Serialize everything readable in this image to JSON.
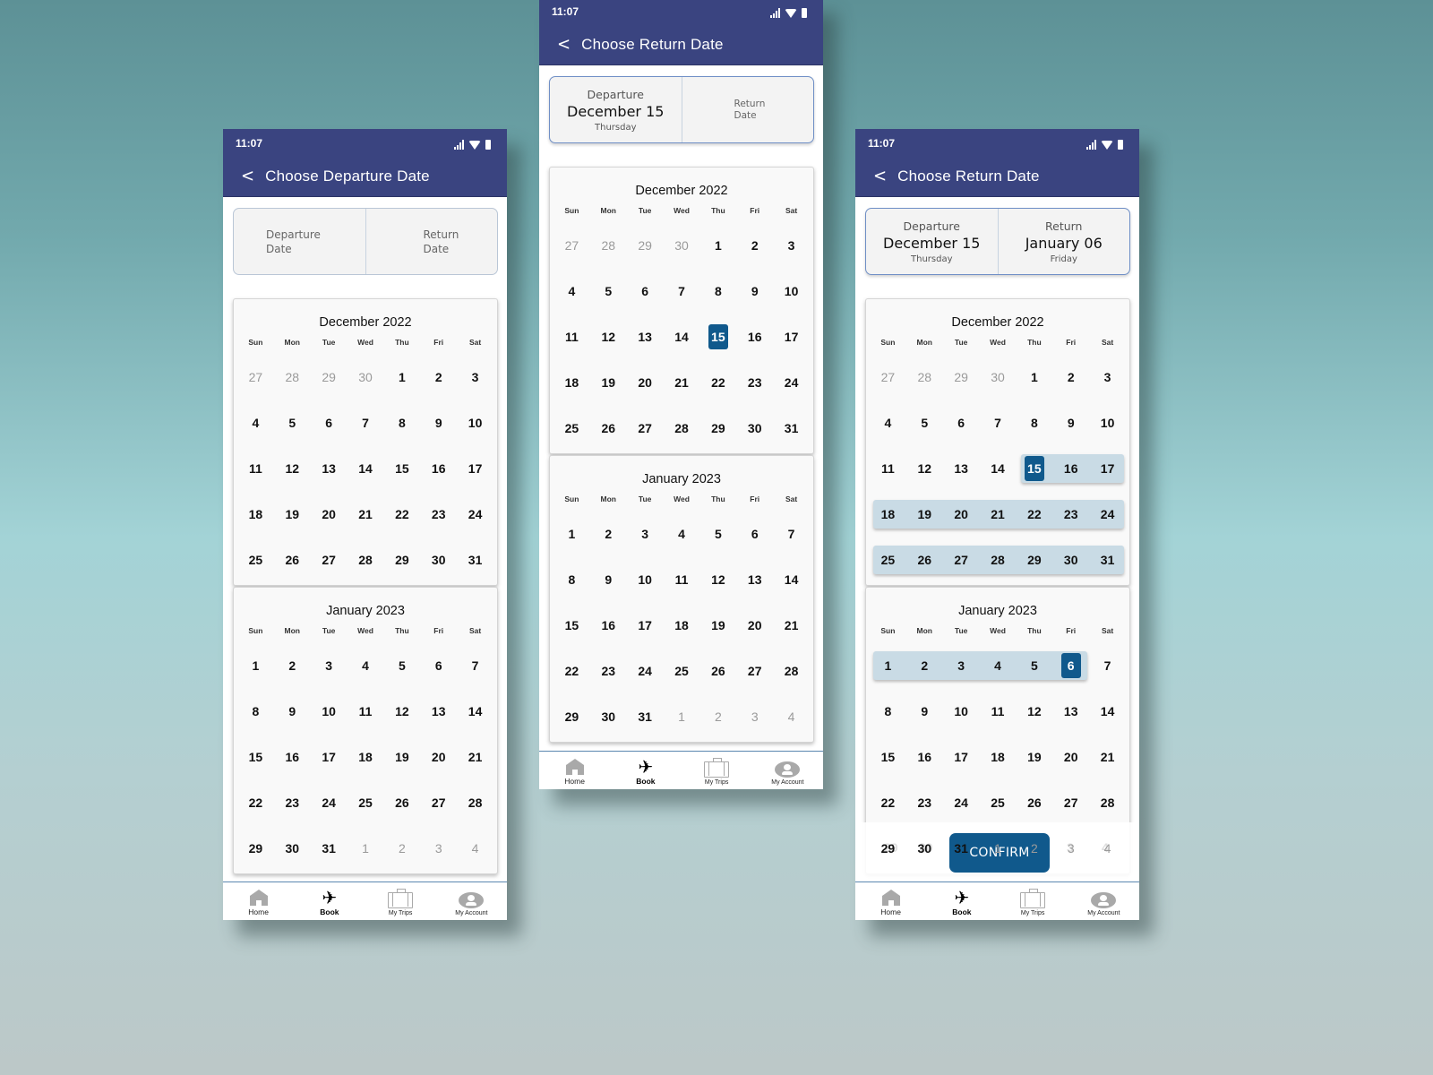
{
  "colors": {
    "appbar": "#3a4480",
    "selected_day": "#10598c",
    "range_fill": "#c9dbe5",
    "confirm_button": "#10598c"
  },
  "weekday_headers": [
    "Sun",
    "Mon",
    "Tue",
    "Wed",
    "Thu",
    "Fri",
    "Sat"
  ],
  "nav": {
    "items": [
      {
        "label": "Home",
        "icon": "home-icon"
      },
      {
        "label": "Book",
        "icon": "airplane-icon",
        "active": true
      },
      {
        "label": "My Trips",
        "icon": "suitcase-icon"
      },
      {
        "label": "My Account",
        "icon": "account-icon"
      }
    ]
  },
  "status": {
    "time": "11:07"
  },
  "months": {
    "dec": {
      "title": "December 2022",
      "weeks": [
        [
          [
            "27",
            1
          ],
          [
            "28",
            1
          ],
          [
            "29",
            1
          ],
          [
            "30",
            1
          ],
          [
            "1",
            0
          ],
          [
            "2",
            0
          ],
          [
            "3",
            0
          ]
        ],
        [
          [
            "4",
            0
          ],
          [
            "5",
            0
          ],
          [
            "6",
            0
          ],
          [
            "7",
            0
          ],
          [
            "8",
            0
          ],
          [
            "9",
            0
          ],
          [
            "10",
            0
          ]
        ],
        [
          [
            "11",
            0
          ],
          [
            "12",
            0
          ],
          [
            "13",
            0
          ],
          [
            "14",
            0
          ],
          [
            "15",
            0
          ],
          [
            "16",
            0
          ],
          [
            "17",
            0
          ]
        ],
        [
          [
            "18",
            0
          ],
          [
            "19",
            0
          ],
          [
            "20",
            0
          ],
          [
            "21",
            0
          ],
          [
            "22",
            0
          ],
          [
            "23",
            0
          ],
          [
            "24",
            0
          ]
        ],
        [
          [
            "25",
            0
          ],
          [
            "26",
            0
          ],
          [
            "27",
            0
          ],
          [
            "28",
            0
          ],
          [
            "29",
            0
          ],
          [
            "30",
            0
          ],
          [
            "31",
            0
          ]
        ]
      ]
    },
    "jan": {
      "title": "January 2023",
      "weeks": [
        [
          [
            "1",
            0
          ],
          [
            "2",
            0
          ],
          [
            "3",
            0
          ],
          [
            "4",
            0
          ],
          [
            "5",
            0
          ],
          [
            "6",
            0
          ],
          [
            "7",
            0
          ]
        ],
        [
          [
            "8",
            0
          ],
          [
            "9",
            0
          ],
          [
            "10",
            0
          ],
          [
            "11",
            0
          ],
          [
            "12",
            0
          ],
          [
            "13",
            0
          ],
          [
            "14",
            0
          ]
        ],
        [
          [
            "15",
            0
          ],
          [
            "16",
            0
          ],
          [
            "17",
            0
          ],
          [
            "18",
            0
          ],
          [
            "19",
            0
          ],
          [
            "20",
            0
          ],
          [
            "21",
            0
          ]
        ],
        [
          [
            "22",
            0
          ],
          [
            "23",
            0
          ],
          [
            "24",
            0
          ],
          [
            "25",
            0
          ],
          [
            "26",
            0
          ],
          [
            "27",
            0
          ],
          [
            "28",
            0
          ]
        ],
        [
          [
            "29",
            0
          ],
          [
            "30",
            0
          ],
          [
            "31",
            0
          ],
          [
            "1",
            1
          ],
          [
            "2",
            1
          ],
          [
            "3",
            1
          ],
          [
            "4",
            1
          ]
        ]
      ]
    }
  },
  "screens": [
    {
      "title": "Choose Departure Date",
      "departure": {
        "placeholder_line1": "Departure",
        "placeholder_line2": "Date"
      },
      "return": {
        "placeholder_line1": "Return",
        "placeholder_line2": "Date"
      },
      "selected": [],
      "range": null
    },
    {
      "title": "Choose Return Date",
      "departure": {
        "label": "Departure",
        "date": "December 15",
        "weekday": "Thursday"
      },
      "return": {
        "placeholder_line1": "Return",
        "placeholder_line2": "Date"
      },
      "selected": [
        {
          "month": "dec",
          "day": "15"
        }
      ],
      "range": null
    },
    {
      "title": "Choose Return Date",
      "departure": {
        "label": "Departure",
        "date": "December 15",
        "weekday": "Thursday"
      },
      "return": {
        "label": "Return",
        "date": "January 06",
        "weekday": "Friday"
      },
      "selected": [
        {
          "month": "dec",
          "day": "15"
        },
        {
          "month": "jan",
          "day": "6"
        }
      ],
      "range": {
        "start": "December 15",
        "end": "January 6"
      },
      "confirm_label": "CONFIRM",
      "confirm_ghost_days": [
        "29",
        "30",
        "3",
        "4"
      ]
    }
  ]
}
